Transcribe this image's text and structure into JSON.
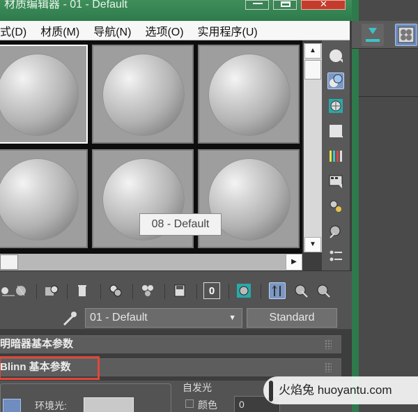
{
  "window": {
    "title": "材质编辑器 - 01 - Default",
    "close_glyph": "✕"
  },
  "menubar": {
    "items": [
      "式(D)",
      "材质(M)",
      "导航(N)",
      "选项(O)",
      "实用程序(U)"
    ]
  },
  "slots": {
    "tooltip": "08 - Default",
    "active_index": 0,
    "scroll_up": "▲",
    "scroll_down": "▼",
    "scroll_right": "▶"
  },
  "side_toolbar": {
    "icons": [
      "sample-sphere-icon",
      "backlight-icon",
      "checker-background-icon",
      "sample-uv-icon",
      "video-color-check-icon",
      "make-preview-icon",
      "options-icon",
      "select-by-material-icon",
      "material-map-navigator-icon"
    ]
  },
  "bottom_toolbar": {
    "icons": [
      "get-material-icon",
      "put-to-scene-icon",
      "assign-to-selection-icon",
      "reset-map-icon",
      "make-copy-icon",
      "make-unique-icon",
      "put-to-library-icon",
      "material-id-channel-icon",
      "show-in-viewport-icon",
      "show-end-result-icon",
      "go-to-parent-icon",
      "go-forward-sibling-icon"
    ],
    "material_id": "0"
  },
  "material": {
    "name": "01 - Default",
    "type": "Standard",
    "dropdown_glyph": "▼"
  },
  "rollouts": {
    "shader_basic": "明暗器基本参数",
    "blinn_basic": "Blinn 基本参数"
  },
  "params": {
    "ambient_label": "环境光:",
    "self_illum_title": "自发光",
    "color_label": "颜色",
    "color_value": "0"
  },
  "watermark": {
    "text": "火焰兔 huoyantu.com"
  }
}
